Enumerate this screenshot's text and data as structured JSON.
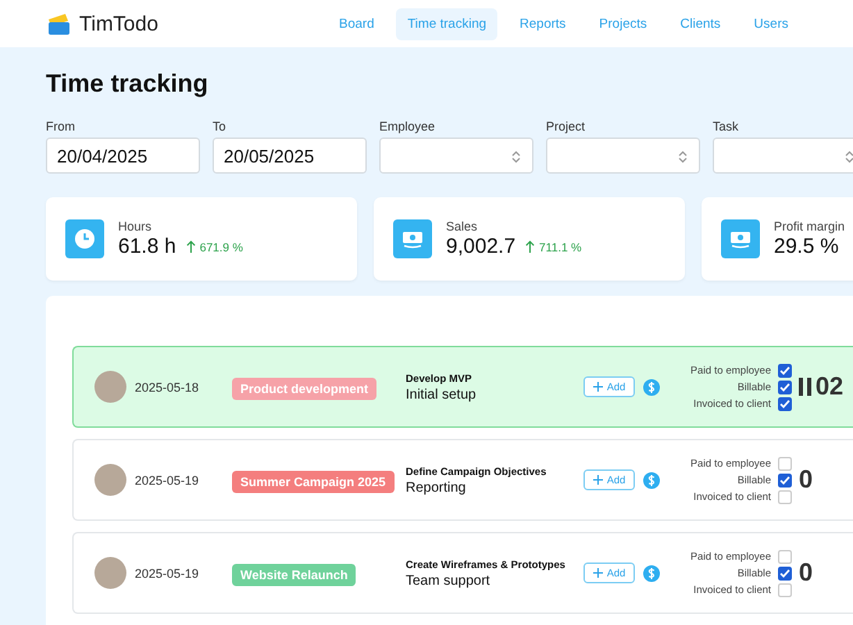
{
  "app": {
    "name": "TimTodo"
  },
  "nav": [
    {
      "label": "Board",
      "selected": false
    },
    {
      "label": "Time tracking",
      "selected": true
    },
    {
      "label": "Reports",
      "selected": false
    },
    {
      "label": "Projects",
      "selected": false
    },
    {
      "label": "Clients",
      "selected": false
    },
    {
      "label": "Users",
      "selected": false
    }
  ],
  "page_title": "Time tracking",
  "filters": [
    {
      "label": "From",
      "kind": "date",
      "value": "20/04/2025"
    },
    {
      "label": "To",
      "kind": "date",
      "value": "20/05/2025"
    },
    {
      "label": "Employee",
      "kind": "select"
    },
    {
      "label": "Project",
      "kind": "select"
    },
    {
      "label": "Task",
      "kind": "select"
    }
  ],
  "stats": [
    {
      "label": "Hours",
      "kind": "clock",
      "value": "61.8 h",
      "change": "671.9 %"
    },
    {
      "label": "Sales",
      "kind": "money",
      "value": "9,002.7",
      "change": "711.1 %"
    },
    {
      "label": "Profit margin",
      "kind": "money",
      "value": "29.5 %"
    }
  ],
  "rows": [
    {
      "active": true,
      "date": "2025-05-18",
      "project": "Product development",
      "color": "#f6a2a8",
      "task": "Develop MVP",
      "activity": "Initial setup",
      "add": "Add",
      "checks": [
        {
          "label": "Paid to employee",
          "checked": true
        },
        {
          "label": "Billable",
          "checked": true
        },
        {
          "label": "Invoiced to client",
          "checked": true
        }
      ],
      "running": true,
      "time": "02"
    },
    {
      "active": false,
      "date": "2025-05-19",
      "project": "Summer Campaign 2025",
      "color": "#f47e7e",
      "task": "Define Campaign Objectives",
      "activity": "Reporting",
      "add": "Add",
      "checks": [
        {
          "label": "Paid to employee",
          "checked": false
        },
        {
          "label": "Billable",
          "checked": true
        },
        {
          "label": "Invoiced to client",
          "checked": false
        }
      ],
      "running": false,
      "time": "0"
    },
    {
      "active": false,
      "date": "2025-05-19",
      "project": "Website Relaunch",
      "color": "#6fd29b",
      "task": "Create Wireframes & Prototypes",
      "activity": "Team support",
      "add": "Add",
      "checks": [
        {
          "label": "Paid to employee",
          "checked": false
        },
        {
          "label": "Billable",
          "checked": true
        },
        {
          "label": "Invoiced to client",
          "checked": false
        }
      ],
      "running": false,
      "time": "0"
    }
  ]
}
